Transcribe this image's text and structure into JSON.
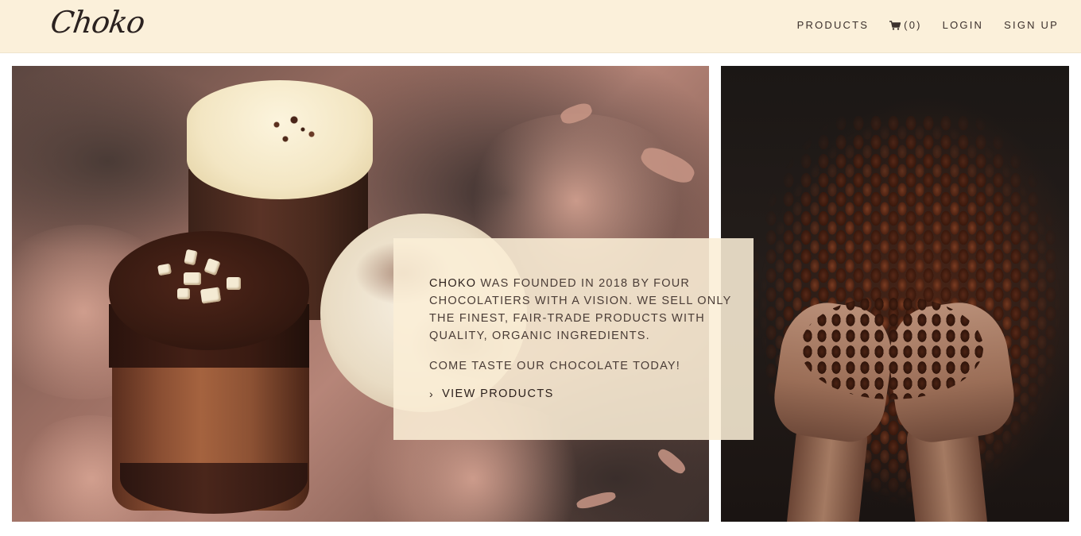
{
  "brand": {
    "logo_text": "Choko"
  },
  "nav": {
    "products_label": "PRODUCTS",
    "cart_icon": "shopping-cart-icon",
    "cart_count": "(0)",
    "login_label": "LOGIN",
    "signup_label": "SIGN UP"
  },
  "hero": {
    "left_image": "chocolate-desserts-photo",
    "right_image": "cocoa-beans-in-hands-photo"
  },
  "info": {
    "brand_word": "CHOKO",
    "paragraph1_rest": " WAS FOUNDED IN 2018 BY FOUR CHOCOLATIERS WITH A VISION. WE SELL ONLY THE FINEST, FAIR-TRADE PRODUCTS WITH QUALITY, ORGANIC INGREDIENTS.",
    "paragraph2": "COME TASTE OUR CHOCOLATE TODAY!",
    "link_icon": "chevron-right-icon",
    "link_label": "VIEW PRODUCTS"
  },
  "colors": {
    "header_bg": "#fbf0da",
    "card_bg": "#fbeed6",
    "text_dark": "#2b1f1b"
  }
}
